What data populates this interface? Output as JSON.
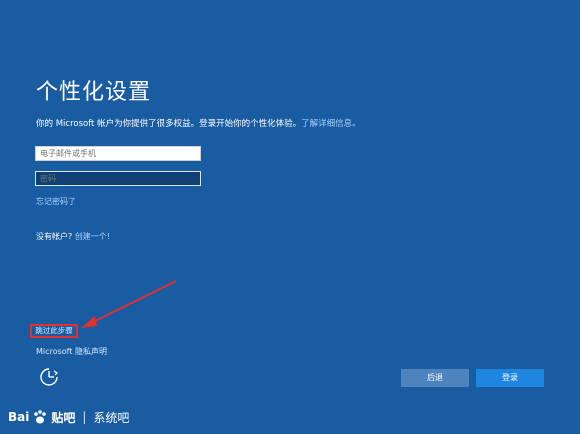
{
  "page": {
    "title": "个性化设置",
    "subtitle_prefix": "你的 Microsoft 帐户为你提供了很多权益。登录开始你的个性化体验。",
    "subtitle_link": "了解详细信息。"
  },
  "form": {
    "email_placeholder": "电子邮件或手机",
    "password_placeholder": "密码",
    "forgot_password": "忘记密码了",
    "no_account_prefix": "没有帐户?",
    "create_account": "创建一个!"
  },
  "footer": {
    "skip_step": "跳过此步骤",
    "privacy": "Microsoft 隐私声明",
    "back_button": "后退",
    "login_button": "登录"
  },
  "watermark": {
    "bai": "Bai",
    "tieba": "贴吧",
    "separator": "|",
    "site": "系统吧"
  },
  "colors": {
    "background": "#1a5ca2",
    "link": "#a9d3ff",
    "highlight": "#e0312f",
    "login_button": "#1f86e0",
    "back_button": "#4d84bd"
  }
}
